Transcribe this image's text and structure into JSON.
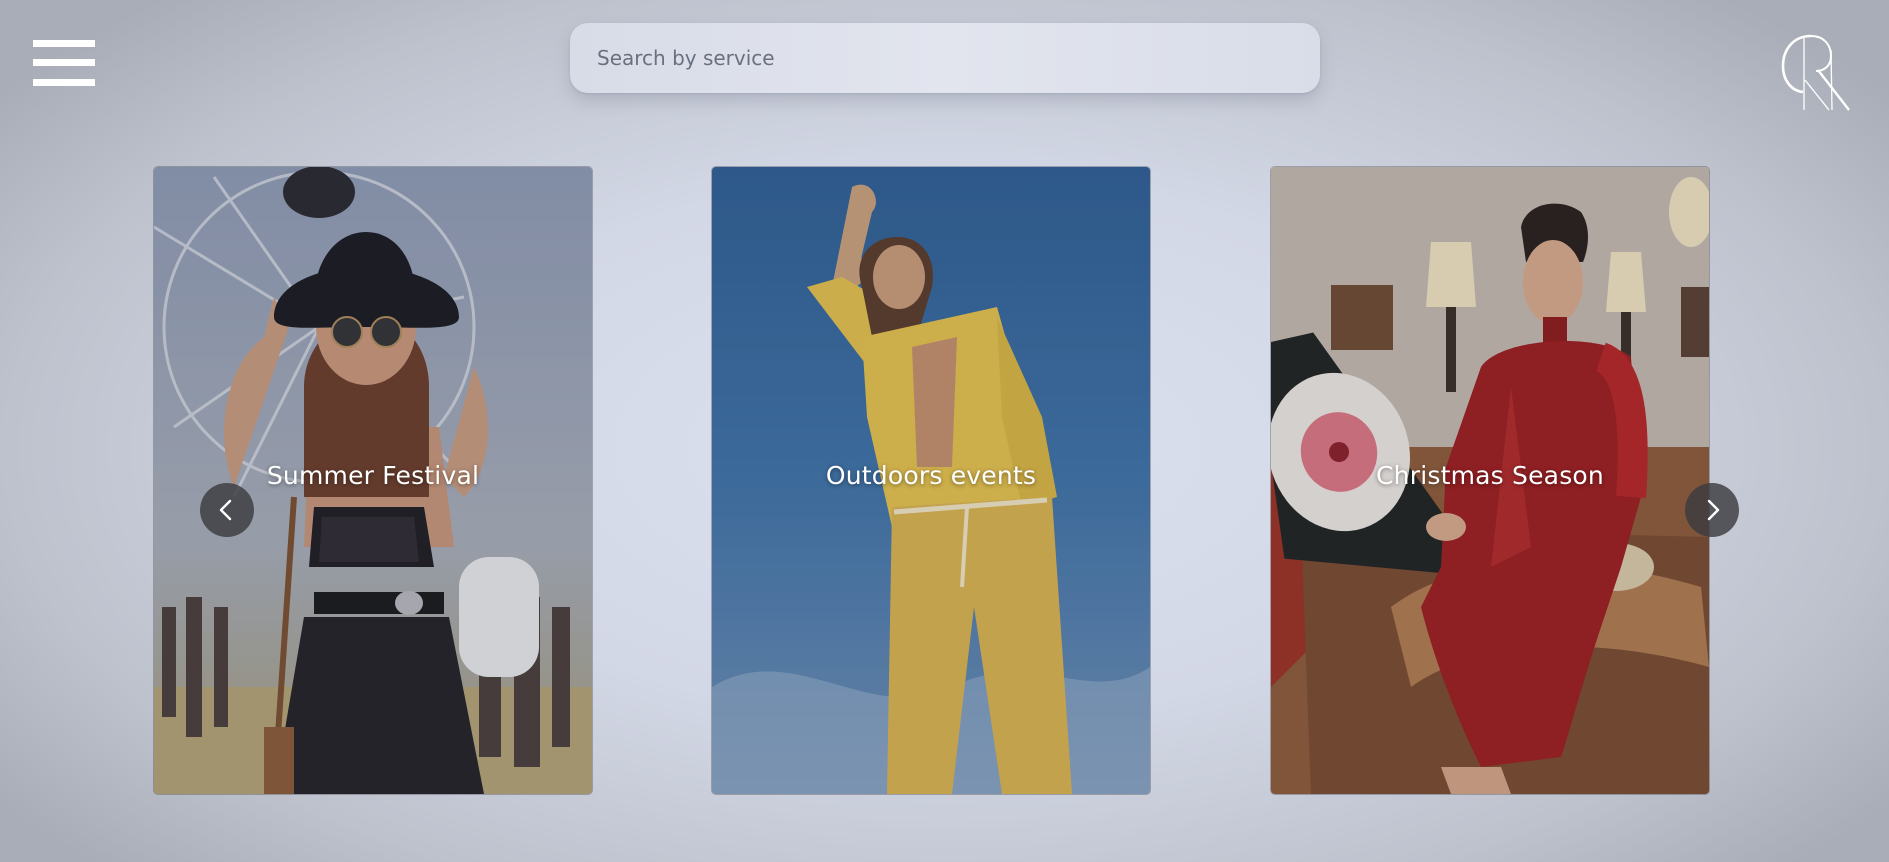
{
  "header": {
    "menu_icon": "hamburger-menu-icon",
    "logo_icon": "brand-monogram-logo"
  },
  "search": {
    "placeholder": "Search by service",
    "value": ""
  },
  "carousel": {
    "prev_icon": "chevron-left-icon",
    "next_icon": "chevron-right-icon",
    "cards": [
      {
        "label": "Summer Festival"
      },
      {
        "label": "Outdoors events"
      },
      {
        "label": "Christmas Season"
      }
    ]
  },
  "colors": {
    "background": "#d3d8e6",
    "search_bg": "#e0e3ec",
    "label_text": "#ffffff",
    "arrow_bg": "#3c3c40"
  }
}
